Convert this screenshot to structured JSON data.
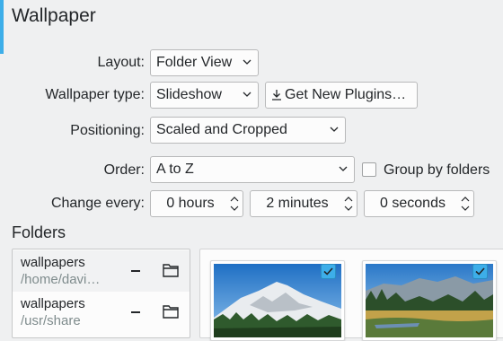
{
  "title": "Wallpaper",
  "accent_color": "#3daee9",
  "form": {
    "layout_label": "Layout:",
    "layout_value": "Folder View",
    "wallpaper_type_label": "Wallpaper type:",
    "wallpaper_type_value": "Slideshow",
    "get_plugins_label": "Get New Plugins…",
    "positioning_label": "Positioning:",
    "positioning_value": "Scaled and Cropped",
    "order_label": "Order:",
    "order_value": "A to Z",
    "group_by_folders_label": "Group by folders",
    "group_by_folders_checked": false,
    "change_every_label": "Change every:",
    "hours_value": "0 hours",
    "minutes_value": "2 minutes",
    "seconds_value": "0 seconds"
  },
  "folders_section": {
    "title": "Folders",
    "items": [
      {
        "name": "wallpapers",
        "path": "/home/davi…"
      },
      {
        "name": "wallpapers",
        "path": "/usr/share"
      }
    ]
  },
  "wallpapers": [
    {
      "subject": "snowy mountain",
      "selected": true
    },
    {
      "subject": "lake meadow",
      "selected": true
    }
  ],
  "icons": [
    "chevron-down-icon",
    "download-icon",
    "spinner-arrows-icon",
    "minus-icon",
    "folder-open-icon",
    "checkmark-icon"
  ]
}
